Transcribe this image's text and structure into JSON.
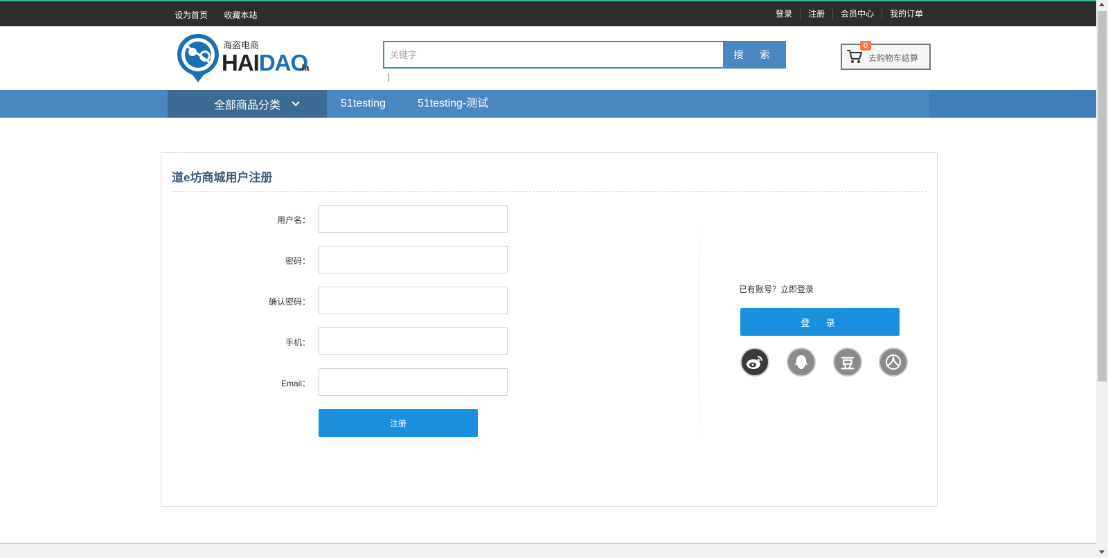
{
  "topbar": {
    "left": [
      "设为首页",
      "收藏本站"
    ],
    "right": [
      "登录",
      "注册",
      "会员中心",
      "我的订单"
    ]
  },
  "logo": {
    "cn": "海盗电商",
    "brand_a": "HAI",
    "brand_b": "DAO",
    "suffix": ".la"
  },
  "search": {
    "placeholder": "关键字",
    "button": "搜 索"
  },
  "cart": {
    "label": "去购物车结算",
    "count": "0"
  },
  "nav": {
    "all_categories": "全部商品分类",
    "links": [
      "51testing",
      "51testing-测试"
    ]
  },
  "register": {
    "title": "道e坊商城用户注册",
    "fields": [
      {
        "label": "用户名：",
        "value": ""
      },
      {
        "label": "密码：",
        "value": ""
      },
      {
        "label": "确认密码：",
        "value": ""
      },
      {
        "label": "手机：",
        "value": ""
      },
      {
        "label": "Email：",
        "value": ""
      }
    ],
    "submit": "注册"
  },
  "login": {
    "prompt": "已有账号？",
    "link": "立即登录",
    "button": "登 录",
    "social": [
      "weibo-icon",
      "qq-icon",
      "douban-icon",
      "renren-icon"
    ]
  },
  "colors": {
    "topbar": "#2d2d2d",
    "nav": "#4a87c0",
    "nav_dark": "#3b6a92",
    "primary_button": "#1a8fde",
    "badge": "#f07b4c",
    "title": "#3a5b7a"
  }
}
